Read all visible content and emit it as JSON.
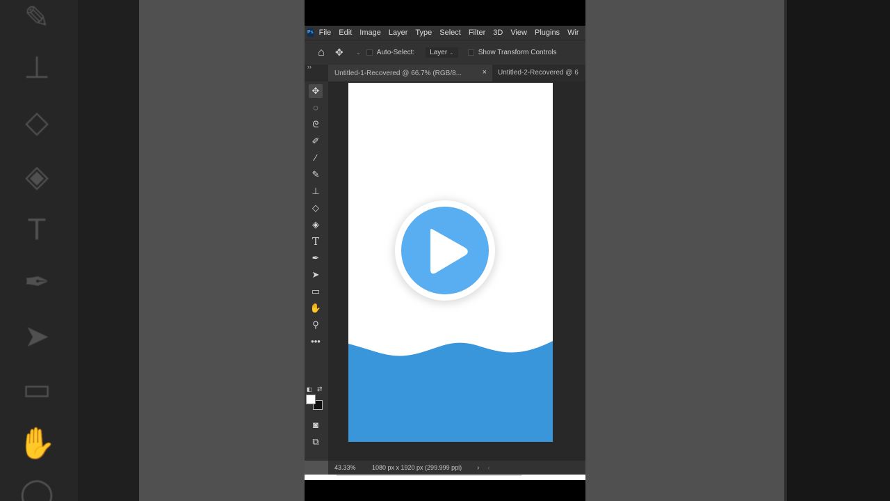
{
  "app": {
    "logo_text": "Ps",
    "menu": [
      "File",
      "Edit",
      "Image",
      "Layer",
      "Type",
      "Select",
      "Filter",
      "3D",
      "View",
      "Plugins",
      "Wir"
    ]
  },
  "options_bar": {
    "auto_select_label": "Auto-Select:",
    "layer_value": "Layer",
    "transform_label": "Show Transform Controls"
  },
  "tabs": [
    {
      "label": "Untitled-1-Recovered @ 66.7% (RGB/8...",
      "close": "×"
    },
    {
      "label": "Untitled-2-Recovered @ 6"
    }
  ],
  "panel_collapse": "››",
  "tools": [
    "move-tool",
    "elliptical-marquee-tool",
    "lasso-tool",
    "quick-selection-tool",
    "eyedropper-tool",
    "brush-tool",
    "clone-stamp-tool",
    "eraser-tool",
    "paint-bucket-tool",
    "type-tool",
    "pen-tool",
    "path-selection-tool",
    "rectangle-tool",
    "hand-tool",
    "zoom-tool",
    "more-tools"
  ],
  "status_bar": {
    "zoom": "43.33%",
    "dimensions": "1080 px x 1920 px (299.999 ppi)",
    "arrow": "›",
    "arrow2": "‹"
  },
  "canvas": {
    "background": "#ffffff",
    "wave_color": "#3a96db",
    "play_circle_color": "#58aef0",
    "play_ring_color": "#ffffff"
  }
}
